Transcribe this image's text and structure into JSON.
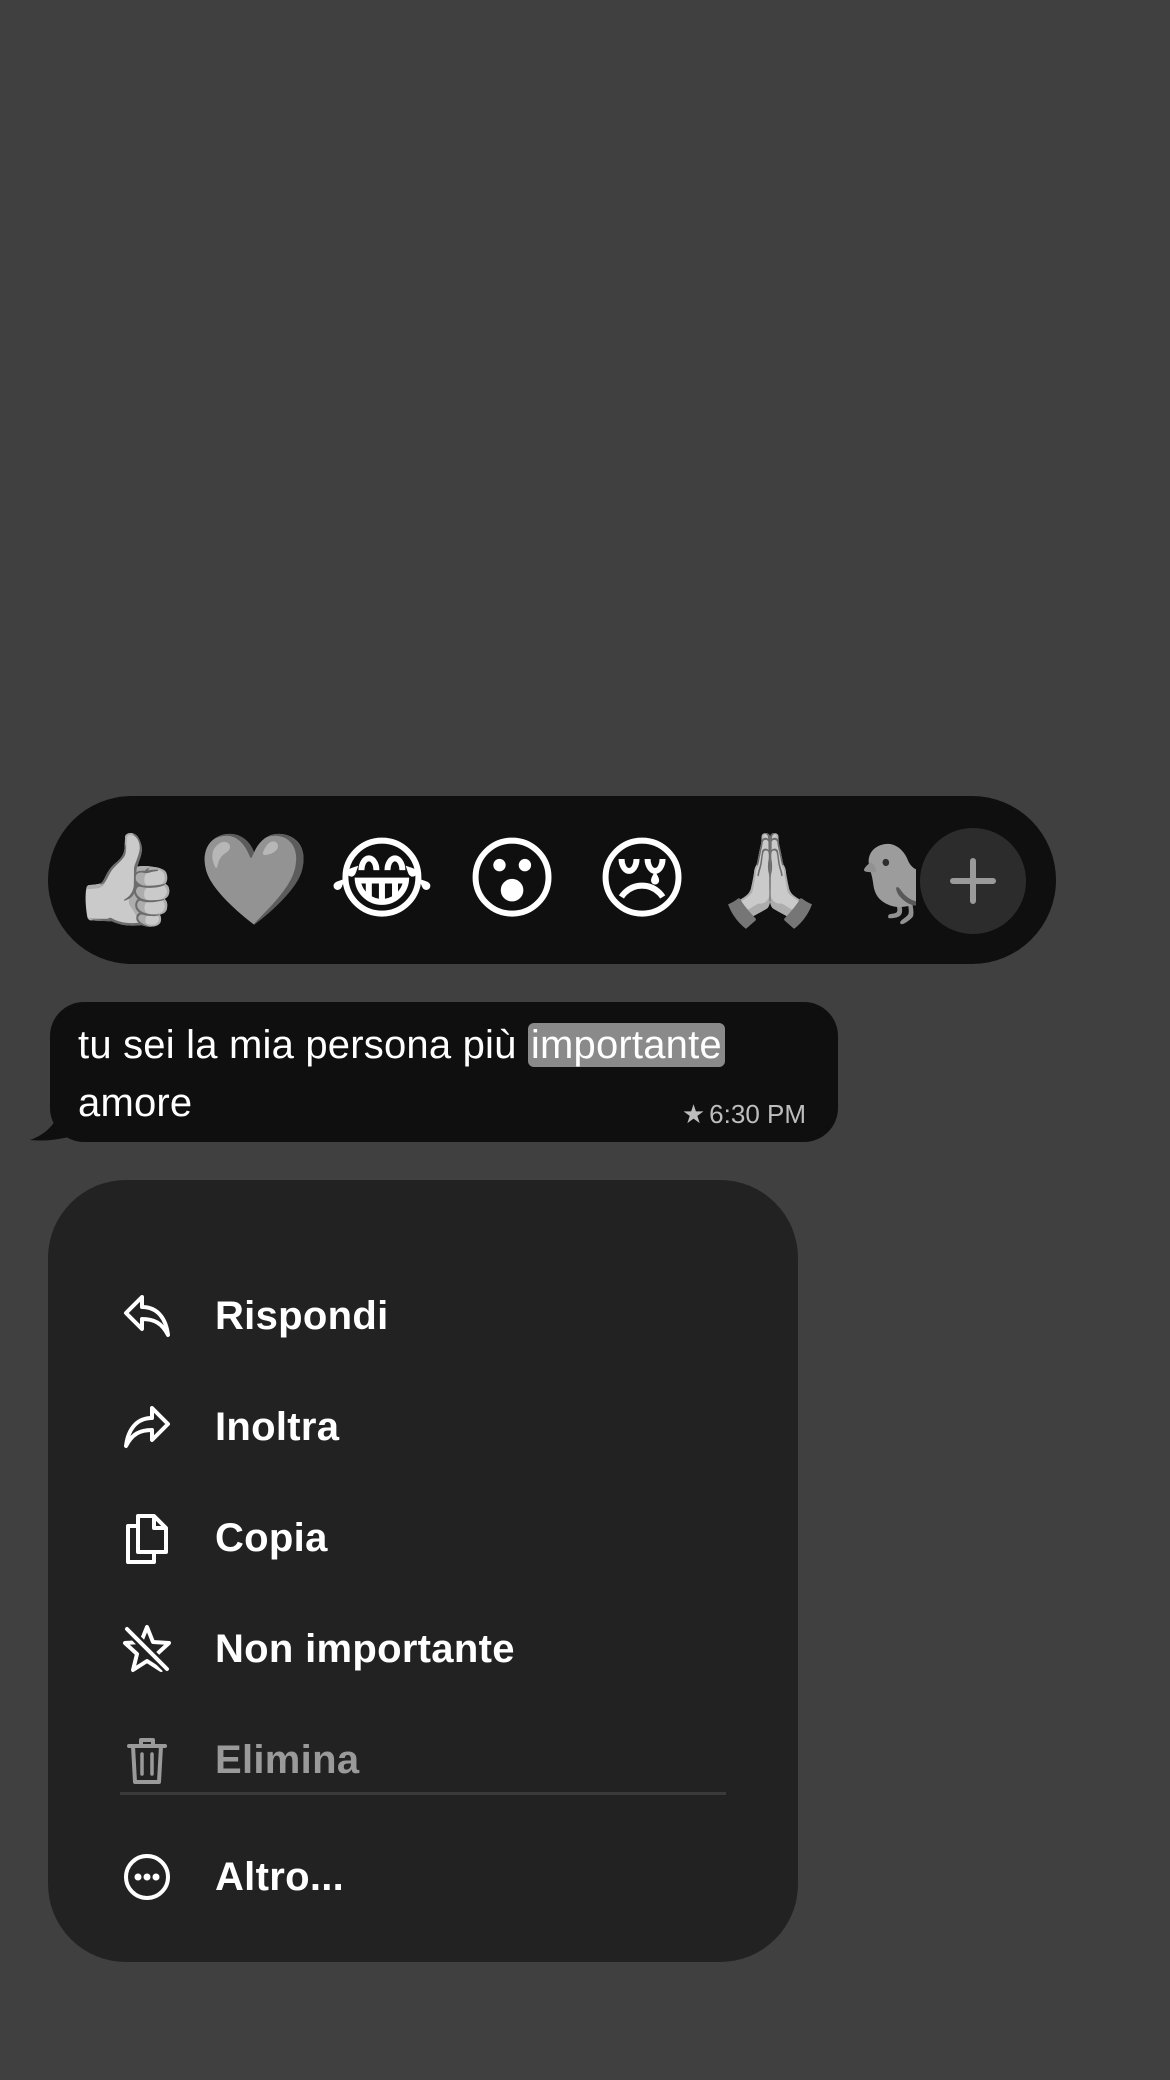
{
  "reactions": [
    {
      "name": "thumbs-up",
      "glyph": "👍"
    },
    {
      "name": "heart",
      "glyph": "🩶"
    },
    {
      "name": "tears-of-joy",
      "glyph": "😂"
    },
    {
      "name": "surprised",
      "glyph": "😮"
    },
    {
      "name": "crying",
      "glyph": "😢"
    },
    {
      "name": "folded-hands",
      "glyph": "🙏"
    },
    {
      "name": "bird",
      "glyph": "🐦"
    }
  ],
  "add_reaction_icon": "plus-icon",
  "message": {
    "text_before": "tu sei la mia persona più ",
    "highlighted": "importante",
    "text_after": " amore",
    "star": "★",
    "time": "6:30 PM"
  },
  "menu": {
    "items": [
      {
        "label": "Rispondi",
        "icon": "reply-icon"
      },
      {
        "label": "Inoltra",
        "icon": "forward-icon"
      },
      {
        "label": "Copia",
        "icon": "copy-icon"
      },
      {
        "label": "Non importante",
        "icon": "unstar-icon"
      },
      {
        "label": "Elimina",
        "icon": "trash-icon"
      },
      {
        "label": "Altro...",
        "icon": "more-icon"
      }
    ]
  },
  "colors": {
    "background": "#404040",
    "bubble": "#0f0f0f",
    "menu": "#222222",
    "highlight": "#8a8a8a",
    "disabled_text": "#9a9a9a"
  }
}
